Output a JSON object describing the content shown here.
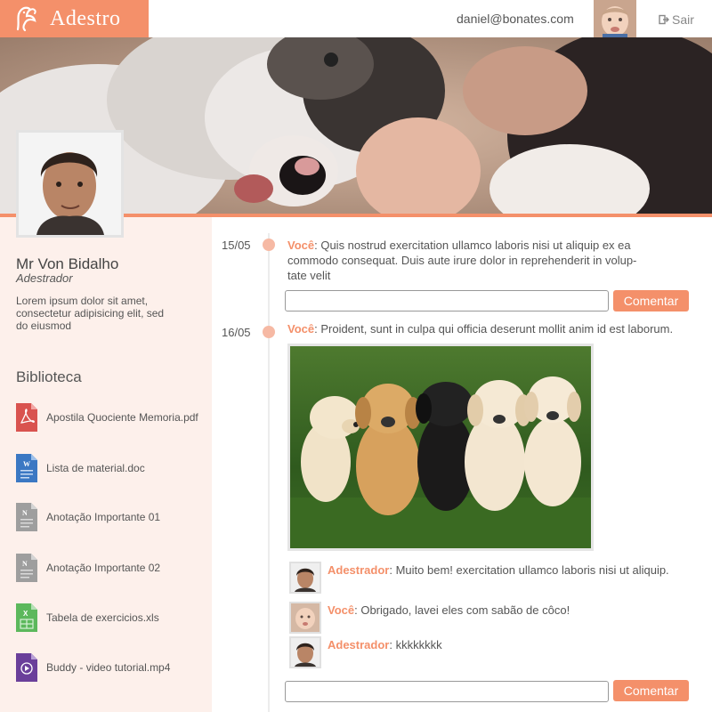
{
  "app": {
    "name": "Adestro"
  },
  "header": {
    "user_email": "daniel@bonates.com",
    "logout_label": "Sair"
  },
  "profile": {
    "name": "Mr Von Bidalho",
    "role": "Adestrador",
    "bio": "Lorem ipsum dolor sit amet, consectetur adipisicing elit, sed do eiusmod"
  },
  "library": {
    "title": "Biblioteca",
    "items": [
      {
        "label": "Apostila Quociente Memoria.pdf",
        "icon": "pdf-file-icon",
        "color": "#d9534f"
      },
      {
        "label": "Lista de material.doc",
        "icon": "word-file-icon",
        "color": "#3b78c3"
      },
      {
        "label": "Anotação Importante 01",
        "icon": "note-file-icon",
        "color": "#9e9e9e"
      },
      {
        "label": "Anotação Importante 02",
        "icon": "note-file-icon",
        "color": "#9e9e9e"
      },
      {
        "label": "Tabela de exercicios.xls",
        "icon": "excel-file-icon",
        "color": "#5cb85c"
      },
      {
        "label": "Buddy - video tutorial.mp4",
        "icon": "video-file-icon",
        "color": "#6a3f9a"
      }
    ]
  },
  "timeline": {
    "posts": [
      {
        "date": "15/05",
        "author": "Você",
        "text": ": Quis nostrud exercitation ullamco laboris nisi ut aliquip ex ea commodo consequat. Duis aute irure dolor in reprehenderit in volup-tate velit",
        "text_lines": [
          ": Quis nostrud exercitation ullamco laboris nisi ut aliquip ex ea",
          "commodo consequat. Duis aute irure dolor in reprehenderit in volup-",
          "tate velit"
        ],
        "comment_button": "Comentar"
      },
      {
        "date": "16/05",
        "author": "Você",
        "text": ": Proident, sunt in culpa qui officia deserunt mollit anim id est laborum.",
        "replies": [
          {
            "author": "Adestrador",
            "text": ": Muito bem! exercitation ullamco laboris nisi ut aliquip."
          },
          {
            "author": "Você",
            "text": ": Obrigado, lavei eles com sabão de côco!"
          },
          {
            "author": "Adestrador",
            "text": ": kkkkkkkk"
          }
        ],
        "comment_button": "Comentar"
      }
    ]
  },
  "colors": {
    "accent": "#f4906a",
    "sidebar_bg": "#fdf0eb",
    "timeline_dot": "#f6b9a4"
  }
}
